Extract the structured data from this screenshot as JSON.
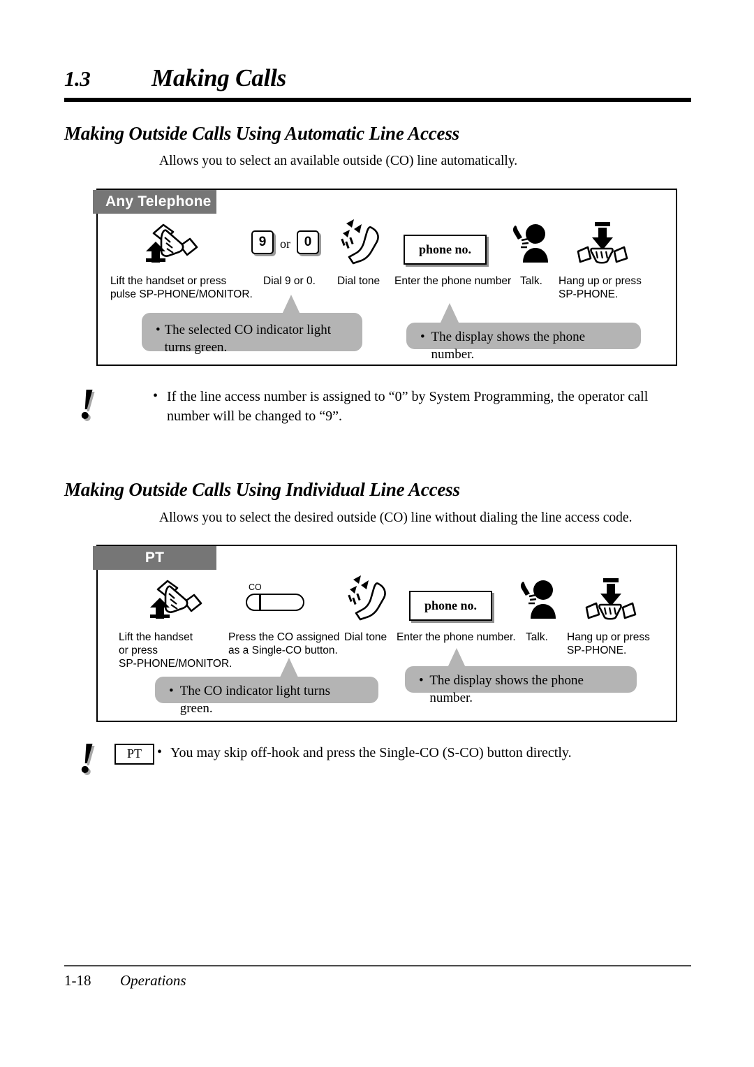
{
  "chapter": {
    "number": "1.3",
    "title": "Making Calls"
  },
  "sections": [
    {
      "title": "Making Outside Calls Using Automatic Line Access",
      "description": "Allows you to select an available outside (CO) line automatically.",
      "tab_label": "Any Telephone",
      "steps": [
        {
          "icon": "lift-handset-icon",
          "label": "Lift the handset or press\npulse SP-PHONE/MONITOR."
        },
        {
          "icon": "dial-keys-icon",
          "key_first": "9",
          "key_or": "or",
          "key_second": "0",
          "label": "Dial 9 or 0."
        },
        {
          "icon": "dial-tone-icon",
          "label": "Dial tone"
        },
        {
          "icon": "display-box-icon",
          "display_text": "phone no.",
          "label": "Enter the phone number"
        },
        {
          "icon": "talk-person-icon",
          "label": "Talk."
        },
        {
          "icon": "hang-up-icon",
          "label": "Hang up or press\nSP-PHONE."
        }
      ],
      "callouts": [
        {
          "bullet": "•",
          "text": "The selected CO indicator light turns green."
        },
        {
          "bullet": "•",
          "text": "The display shows the phone number."
        }
      ],
      "note": {
        "mark": "!",
        "bullet": "•",
        "text": "If the line access number is assigned to “0” by System Programming, the operator call number will be changed to “9”."
      }
    },
    {
      "title": "Making Outside Calls Using Individual Line Access",
      "description": "Allows you to select the desired outside (CO) line without dialing the line access code.",
      "tab_label": "PT",
      "steps": [
        {
          "icon": "lift-handset-icon",
          "label": "Lift the handset\nor press\nSP-PHONE/MONITOR."
        },
        {
          "icon": "co-button-icon",
          "button_name": "CO",
          "label": "Press the CO assigned\nas a Single-CO button."
        },
        {
          "icon": "dial-tone-icon",
          "label": "Dial tone"
        },
        {
          "icon": "display-box-icon",
          "display_text": "phone no.",
          "label": "Enter the phone number."
        },
        {
          "icon": "talk-person-icon",
          "label": "Talk."
        },
        {
          "icon": "hang-up-icon",
          "label": "Hang up or press\nSP-PHONE."
        }
      ],
      "callouts": [
        {
          "bullet": "•",
          "text": "The CO indicator light turns green."
        },
        {
          "bullet": "•",
          "text": "The display shows the phone number."
        }
      ],
      "note": {
        "mark": "!",
        "chip": "PT",
        "bullet": "•",
        "text": "You may skip off-hook and press the Single-CO (S-CO) button directly."
      }
    }
  ],
  "footer": {
    "page_number": "1-18",
    "section_name": "Operations"
  },
  "colors": {
    "tab_gray": "#767676",
    "callout_gray": "#b4b4b4",
    "rule_black": "#000000"
  }
}
